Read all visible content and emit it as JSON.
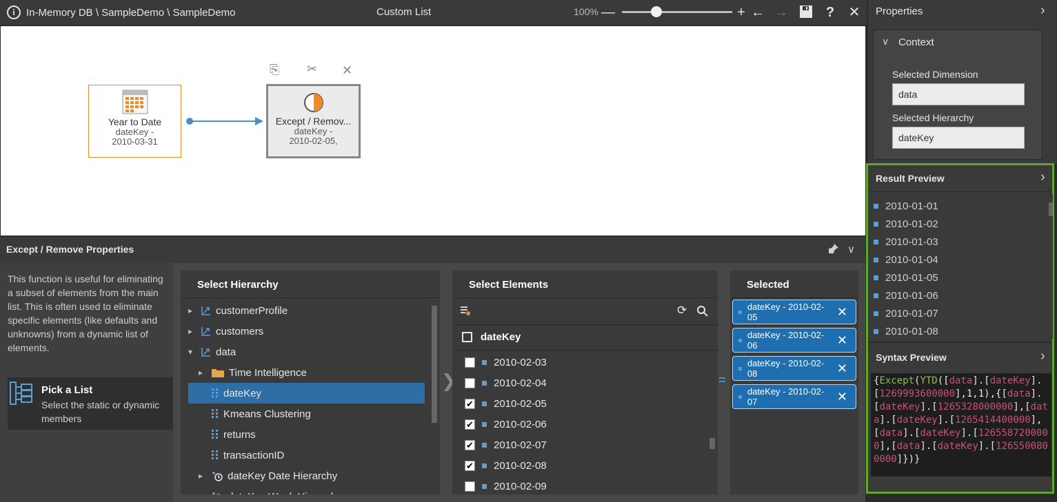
{
  "topbar": {
    "info": "i",
    "path": "In-Memory DB \\ SampleDemo \\ SampleDemo",
    "title": "Custom List",
    "zoom": "100%",
    "zoom_slider_fraction": 0.31,
    "minus": "—",
    "plus": "+",
    "back": "←",
    "forward": "→",
    "help": "?",
    "close": "✕"
  },
  "canvas": {
    "node1": {
      "title": "Year to Date",
      "line1": "dateKey -",
      "line2": "2010-03-31"
    },
    "node2": {
      "title": "Except / Remov...",
      "line1": "dateKey -",
      "line2": "2010-02-05,"
    },
    "node2_actions": {
      "copy": "⎘",
      "cut": "✂",
      "delete": "✕"
    }
  },
  "properties": {
    "title": "Properties",
    "chevron": "›",
    "context": {
      "title": "Context",
      "chevron": "∨",
      "selected_dimension_label": "Selected Dimension",
      "selected_dimension_value": "data",
      "selected_hierarchy_label": "Selected Hierarchy",
      "selected_hierarchy_value": "dateKey"
    }
  },
  "result_preview": {
    "title": "Result Preview",
    "chevron": "›",
    "items": [
      "2010-01-01",
      "2010-01-02",
      "2010-01-03",
      "2010-01-04",
      "2010-01-05",
      "2010-01-06",
      "2010-01-07",
      "2010-01-08"
    ]
  },
  "syntax_preview": {
    "title": "Syntax Preview",
    "chevron": "›",
    "tokens": [
      {
        "t": "{",
        "c": "#e6e6e6"
      },
      {
        "t": "Except",
        "c": "#8fbf4a"
      },
      {
        "t": "(",
        "c": "#e6e6e6"
      },
      {
        "t": "YTD",
        "c": "#8fbf4a"
      },
      {
        "t": "([",
        "c": "#e6e6e6"
      },
      {
        "t": "data",
        "c": "#c8507a"
      },
      {
        "t": "].[",
        "c": "#e6e6e6"
      },
      {
        "t": "dateKey",
        "c": "#c8507a"
      },
      {
        "t": "].[",
        "c": "#e6e6e6"
      },
      {
        "t": "1269993600000",
        "c": "#c8507a"
      },
      {
        "t": "],1,1),{[",
        "c": "#e6e6e6"
      },
      {
        "t": "data",
        "c": "#c8507a"
      },
      {
        "t": "].[",
        "c": "#e6e6e6"
      },
      {
        "t": "dateKey",
        "c": "#c8507a"
      },
      {
        "t": "].[",
        "c": "#e6e6e6"
      },
      {
        "t": "1265328000000",
        "c": "#c8507a"
      },
      {
        "t": "],[",
        "c": "#e6e6e6"
      },
      {
        "t": "data",
        "c": "#c8507a"
      },
      {
        "t": "].[",
        "c": "#e6e6e6"
      },
      {
        "t": "dateKey",
        "c": "#c8507a"
      },
      {
        "t": "].[",
        "c": "#e6e6e6"
      },
      {
        "t": "1265414400000",
        "c": "#c8507a"
      },
      {
        "t": "],[",
        "c": "#e6e6e6"
      },
      {
        "t": "data",
        "c": "#c8507a"
      },
      {
        "t": "].[",
        "c": "#e6e6e6"
      },
      {
        "t": "dateKey",
        "c": "#c8507a"
      },
      {
        "t": "].[",
        "c": "#e6e6e6"
      },
      {
        "t": "1265587200000",
        "c": "#c8507a"
      },
      {
        "t": "],[",
        "c": "#e6e6e6"
      },
      {
        "t": "data",
        "c": "#c8507a"
      },
      {
        "t": "].[",
        "c": "#e6e6e6"
      },
      {
        "t": "dateKey",
        "c": "#c8507a"
      },
      {
        "t": "].[",
        "c": "#e6e6e6"
      },
      {
        "t": "1265500800000",
        "c": "#c8507a"
      },
      {
        "t": "]})}",
        "c": "#e6e6e6"
      }
    ]
  },
  "bottom": {
    "title": "Except / Remove Properties",
    "pin": "📌",
    "collapse": "∨",
    "description": "This function is useful for eliminating a subset of elements from the main list. This is often used to eliminate specific elements (like defaults and unknowns) from a dynamic list of elements.",
    "pick_title": "Pick a List",
    "pick_desc": "Select the static or dynamic members",
    "hierarchy_header": "Select Hierarchy",
    "hierarchy_items": [
      {
        "label": "customerProfile",
        "expander": "▸"
      },
      {
        "label": "customers",
        "expander": "▸"
      },
      {
        "label": "data",
        "expander": "▾"
      },
      {
        "label": "Time Intelligence",
        "expander": "▸"
      },
      {
        "label": "dateKey",
        "expander": ""
      },
      {
        "label": "Kmeans Clustering",
        "expander": ""
      },
      {
        "label": "returns",
        "expander": ""
      },
      {
        "label": "transactionID",
        "expander": ""
      },
      {
        "label": "dateKey Date Hierarchy",
        "expander": "▸"
      },
      {
        "label": "dateKey Week Hierarchy",
        "expander": "▸"
      }
    ],
    "elements_header": "Select Elements",
    "elements_root": "dateKey",
    "elements": [
      {
        "label": "2010-02-03",
        "checked": false
      },
      {
        "label": "2010-02-04",
        "checked": false
      },
      {
        "label": "2010-02-05",
        "checked": true
      },
      {
        "label": "2010-02-06",
        "checked": true
      },
      {
        "label": "2010-02-07",
        "checked": true
      },
      {
        "label": "2010-02-08",
        "checked": true
      },
      {
        "label": "2010-02-09",
        "checked": false
      }
    ],
    "selected_header": "Selected",
    "selected": [
      "dateKey - 2010-02-05",
      "dateKey - 2010-02-06",
      "dateKey - 2010-02-08",
      "dateKey - 2010-02-07"
    ],
    "equals": "="
  }
}
